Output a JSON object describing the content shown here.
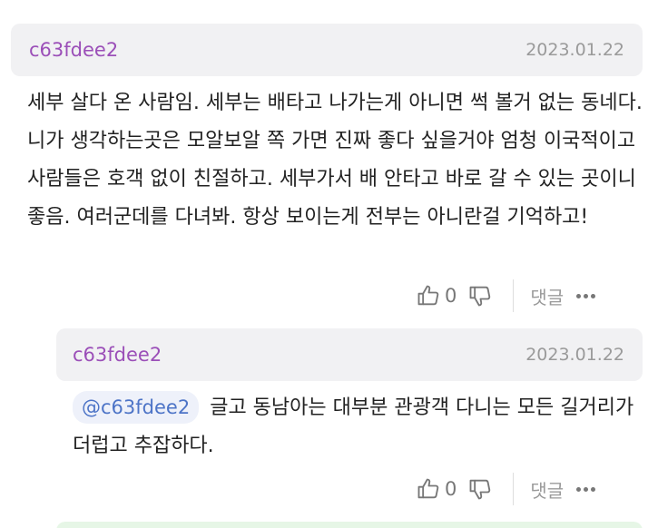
{
  "comments": [
    {
      "username": "c63fdee2",
      "date": "2023.01.22",
      "text": "세부 살다 온 사람임. 세부는 배타고 나가는게 아니면 썩 볼거 없는 동네다. 니가 생각하는곳은 모알보알 쪽 가면 진짜 좋다 싶을거야 엄청 이국적이고 사람들은 호객 없이 친절하고. 세부가서 배 안타고 바로 갈 수 있는 곳이니 좋음. 여러군데를 다녀봐. 항상 보이는게 전부는 아니란걸 기억하고!",
      "like_count": "0",
      "reply_label": "댓글"
    }
  ],
  "replies": [
    {
      "username": "c63fdee2",
      "date": "2023.01.22",
      "mention": "@c63fdee2",
      "text": "글고 동남아는 대부분 관광객 다니는 모든 길거리가 더럽고 추잡하다.",
      "like_count": "0",
      "reply_label": "댓글"
    }
  ],
  "icons": {
    "like": "thumbs-up-icon",
    "dislike": "thumbs-down-icon",
    "more": "more-dots-icon"
  },
  "colors": {
    "username": "#9b4fb8",
    "mention": "#4d74c7",
    "header_bg": "#f1f1f3"
  }
}
